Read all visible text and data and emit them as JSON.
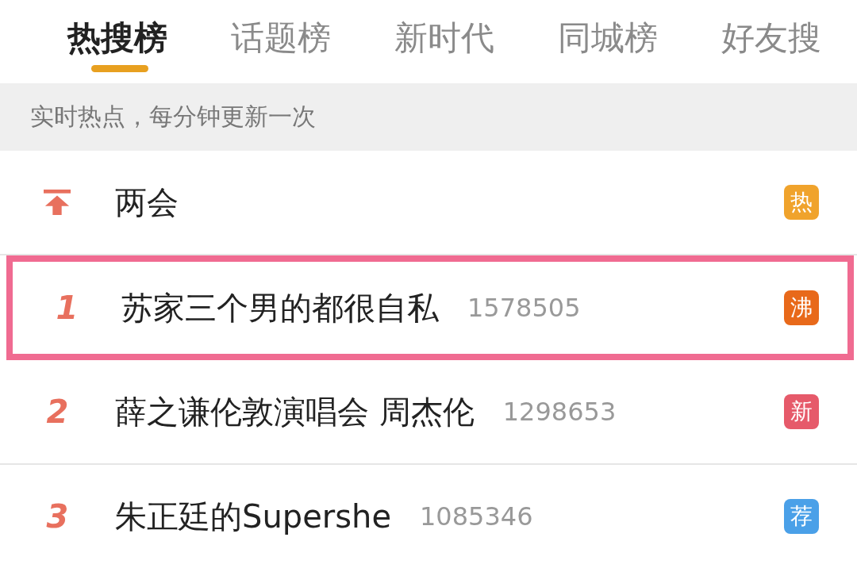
{
  "tabs": [
    {
      "label": "热搜榜",
      "selected": true
    },
    {
      "label": "话题榜",
      "selected": false
    },
    {
      "label": "新时代",
      "selected": false
    },
    {
      "label": "同城榜",
      "selected": false
    },
    {
      "label": "好友搜",
      "selected": false
    }
  ],
  "notice": "实时热点，每分钟更新一次",
  "rows": [
    {
      "kind": "pinned",
      "title": "两会",
      "badge": "热",
      "color": "#f0a32c",
      "highlighted": false
    },
    {
      "kind": "ranked",
      "rank": "1",
      "title": "苏家三个男的都很自私",
      "count": "1578505",
      "badge": "沸",
      "color": "#e8691a",
      "highlighted": true
    },
    {
      "kind": "ranked",
      "rank": "2",
      "title": "薛之谦伦敦演唱会 周杰伦",
      "count": "1298653",
      "badge": "新",
      "color": "#e65a6a",
      "highlighted": false
    },
    {
      "kind": "ranked",
      "rank": "3",
      "title": "朱正廷的Supershe",
      "count": "1085346",
      "badge": "荐",
      "color": "#4aa0e8",
      "highlighted": false
    }
  ]
}
